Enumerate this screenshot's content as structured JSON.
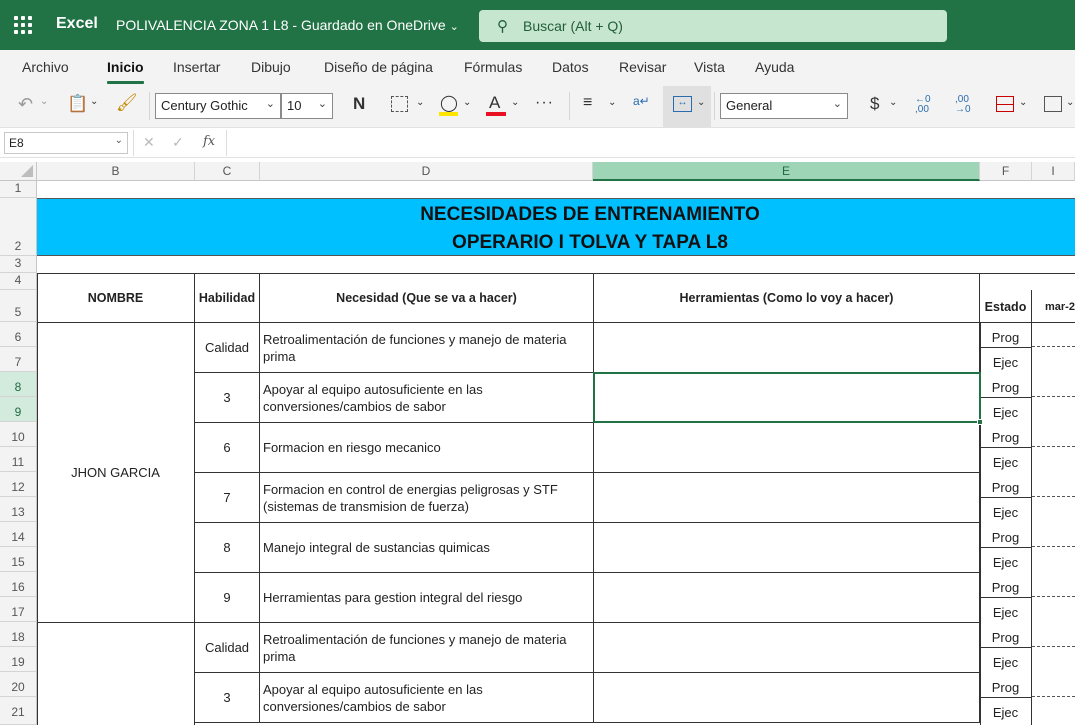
{
  "app": {
    "name": "Excel",
    "document": "POLIVALENCIA ZONA 1 L8",
    "save_status": "Guardado en OneDrive",
    "search_placeholder": "Buscar (Alt + Q)"
  },
  "menu": {
    "tabs": [
      "Archivo",
      "Inicio",
      "Insertar",
      "Dibujo",
      "Diseño de página",
      "Fórmulas",
      "Datos",
      "Revisar",
      "Vista",
      "Ayuda"
    ],
    "active": "Inicio"
  },
  "toolbar": {
    "font_name": "Century Gothic",
    "font_size": "10",
    "number_format": "General",
    "bold_label": "N",
    "font_color_label": "A",
    "more": "···",
    "currency": "$",
    "colors": {
      "highlight": "#ffe600",
      "font": "#e81123"
    }
  },
  "formula_bar": {
    "name_box": "E8",
    "fx": "fx",
    "value": ""
  },
  "grid": {
    "columns": [
      "B",
      "C",
      "D",
      "E",
      "F",
      "I"
    ],
    "selected_column": "E",
    "rows": [
      "1",
      "2",
      "3",
      "4",
      "5",
      "6",
      "7",
      "8",
      "9",
      "10",
      "11",
      "12",
      "13",
      "14",
      "15",
      "16",
      "17",
      "18",
      "19",
      "20",
      "21"
    ],
    "selected_rows": [
      "8",
      "9"
    ]
  },
  "sheet": {
    "title_line1": "NECESIDADES DE ENTRENAMIENTO",
    "title_line2": "OPERARIO I TOLVA Y TAPA L8",
    "headers": {
      "nombre": "NOMBRE",
      "habilidad": "Habilidad",
      "necesidad": "Necesidad (Que se va a hacer)",
      "herramientas": "Herramientas (Como lo voy a hacer)",
      "estado": "Estado",
      "mes": "mar-2"
    },
    "person": "JHON GARCIA",
    "entries": [
      {
        "habilidad": "Calidad",
        "necesidad": "Retroalimentación de funciones y manejo de materia prima"
      },
      {
        "habilidad": "3",
        "necesidad": "Apoyar al equipo autosuficiente en las conversiones/cambios de sabor"
      },
      {
        "habilidad": "6",
        "necesidad": "Formacion en riesgo mecanico"
      },
      {
        "habilidad": "7",
        "necesidad": "Formacion en control de energias peligrosas y STF (sistemas de transmision de fuerza)"
      },
      {
        "habilidad": "8",
        "necesidad": "Manejo integral de sustancias quimicas"
      },
      {
        "habilidad": "9",
        "necesidad": "Herramientas para gestion integral del riesgo"
      },
      {
        "habilidad": "Calidad",
        "necesidad": "Retroalimentación de funciones y manejo de materia prima"
      },
      {
        "habilidad": "3",
        "necesidad": "Apoyar al equipo autosuficiente en las conversiones/cambios de sabor"
      }
    ],
    "estado_prog": "Prog",
    "estado_ejec": "Ejec"
  }
}
